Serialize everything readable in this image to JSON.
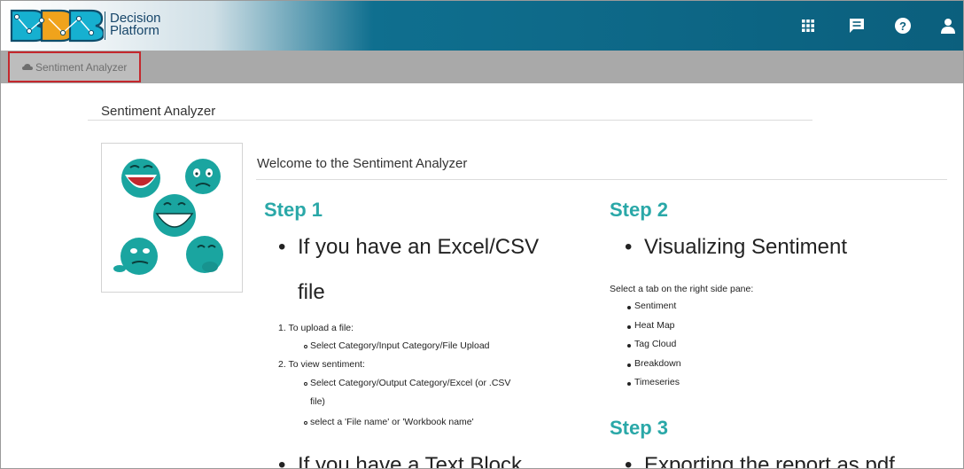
{
  "header": {
    "logo_text": "BDB",
    "brand_line1": "Decision",
    "brand_line2": "Platform",
    "icons": [
      "apps-grid-icon",
      "chat-icon",
      "help-icon",
      "user-icon"
    ]
  },
  "tab": {
    "icon": "cloud-icon",
    "label": "Sentiment Analyzer"
  },
  "page": {
    "title": "Sentiment Analyzer",
    "welcome": "Welcome to the Sentiment Analyzer"
  },
  "step1": {
    "heading": "Step 1",
    "bullet1_line1": "If you have an Excel/CSV",
    "bullet1_line2": "file",
    "items": [
      {
        "num": "1.",
        "text": "To upload a file:"
      },
      {
        "num": "2.",
        "text": "To view sentiment:"
      }
    ],
    "sub_upload": "Select Category/Input Category/File Upload",
    "sub_view1_line1": "Select Category/Output Category/Excel (or .CSV",
    "sub_view1_line2": "file)",
    "sub_view2": "select a 'File name' or 'Workbook name'",
    "bullet2": "If you have a Text Block"
  },
  "step2": {
    "heading": "Step 2",
    "bullet": "Visualizing Sentiment",
    "intro": "Select a tab on the right side pane:",
    "tabs": [
      "Sentiment",
      "Heat Map",
      "Tag Cloud",
      "Breakdown",
      "Timeseries"
    ]
  },
  "step3": {
    "heading": "Step 3",
    "bullet": "Exporting the report as pdf"
  },
  "colors": {
    "accent": "#2aa8a8",
    "header": "#0b5f7d",
    "tab_border": "#c4282d"
  }
}
